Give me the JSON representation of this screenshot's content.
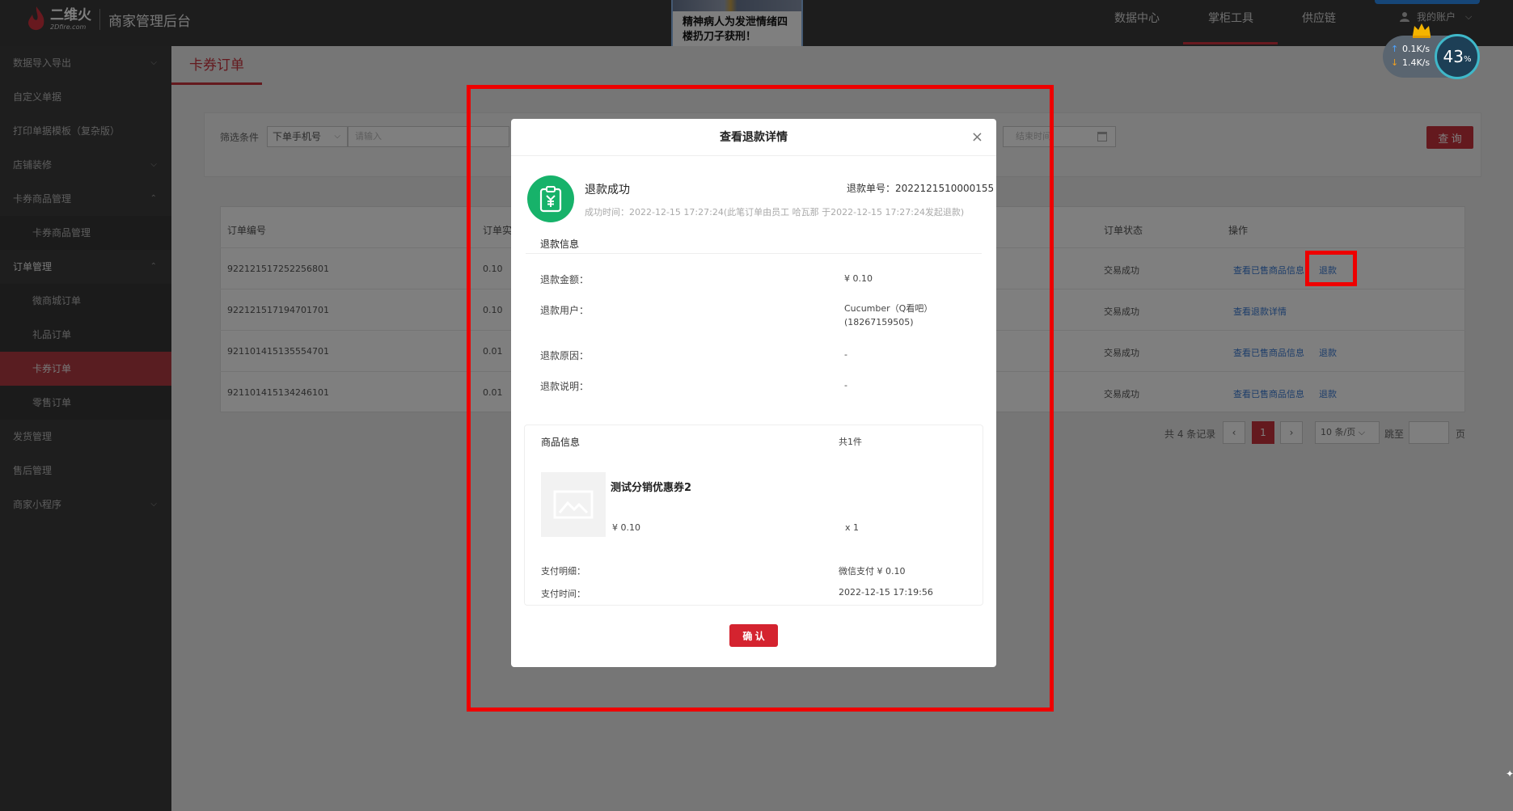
{
  "brand": {
    "logo_cn": "二维火",
    "logo_en": "2Dfire.com",
    "title": "商家管理后台"
  },
  "news": {
    "text": "精神病人为发泄情绪四楼扔刀子获刑！"
  },
  "top_nav": {
    "items": [
      "数据中心",
      "掌柜工具",
      "供应链"
    ],
    "active": "掌柜工具",
    "account": "我的账户"
  },
  "speed": {
    "up": "0.1K/s",
    "down": "1.4K/s",
    "percent": "43",
    "percent_unit": "%"
  },
  "sidebar": {
    "items": [
      {
        "label": "数据导入导出",
        "type": "group",
        "caret": "⌄"
      },
      {
        "label": "自定义单据",
        "type": "item"
      },
      {
        "label": "打印单据模板（复杂版）",
        "type": "item"
      },
      {
        "label": "店铺装修",
        "type": "group",
        "caret": "⌄"
      },
      {
        "label": "卡券商品管理",
        "type": "group",
        "caret": "⌃"
      },
      {
        "label": "卡券商品管理",
        "type": "sub"
      },
      {
        "label": "订单管理",
        "type": "group-strong",
        "caret": "⌃"
      },
      {
        "label": "微商城订单",
        "type": "sub"
      },
      {
        "label": "礼品订单",
        "type": "sub"
      },
      {
        "label": "卡券订单",
        "type": "sub-active"
      },
      {
        "label": "零售订单",
        "type": "sub"
      },
      {
        "label": "发货管理",
        "type": "item"
      },
      {
        "label": "售后管理",
        "type": "item"
      },
      {
        "label": "商家小程序",
        "type": "group",
        "caret": "⌄"
      }
    ]
  },
  "page": {
    "tab": "卡券订单"
  },
  "filter": {
    "label": "筛选条件",
    "select_value": "下单手机号",
    "input_placeholder": "请输入",
    "date_placeholder": "结束时间",
    "query_button": "查 询"
  },
  "table": {
    "headers": [
      "订单编号",
      "订单实",
      "订单状态",
      "操作"
    ],
    "rows": [
      {
        "id": "9221215172522568​01",
        "amount": "0.10",
        "status": "交易成功",
        "actions": [
          "查看已售商品信息",
          "退款"
        ]
      },
      {
        "id": "9221215171947017​01",
        "amount": "0.10",
        "status": "交易成功",
        "actions": [
          "查看退款详情"
        ]
      },
      {
        "id": "9211014151355547​01",
        "amount": "0.01",
        "status": "交易成功",
        "actions": [
          "查看已售商品信息",
          "退款"
        ]
      },
      {
        "id": "9211014151342461​01",
        "amount": "0.01",
        "status": "交易成功",
        "actions": [
          "查看已售商品信息",
          "退款"
        ]
      }
    ]
  },
  "pager": {
    "total": "共 4 条记录",
    "current_page": "1",
    "page_size": "10 条/页",
    "jump_label": "跳至",
    "page_label": "页"
  },
  "modal": {
    "title": "查看退款详情",
    "status": "退款成功",
    "refund_no": "退款单号：2022121510000155",
    "success_time": "成功时间：2022-12-15 17:27:24(此笔订单由员工 哈瓦那 于2022-12-15 17:27:24发起退款)",
    "refund_info_title": "退款信息",
    "refund_info": [
      {
        "label": "退款金额：",
        "value": "¥ 0.10"
      },
      {
        "label": "退款用户：",
        "value": "Cucumber（Q看吧）(18267159505)"
      },
      {
        "label": "退款原因：",
        "value": "-"
      },
      {
        "label": "退款说明：",
        "value": "-"
      }
    ],
    "goods": {
      "title": "商品信息",
      "count": "共1件",
      "name": "测试分销优惠券2",
      "price": "¥ 0.10",
      "qty": "x 1",
      "pay_detail_label": "支付明细：",
      "pay_detail_value": "微信支付 ¥ 0.10",
      "pay_time_label": "支付时间：",
      "pay_time_value": "2022-12-15 17:19:56"
    },
    "confirm": "确 认"
  },
  "colors": {
    "brand_red": "#c9323d",
    "success_green": "#17b26a",
    "link_blue": "#3a7bd5",
    "annotation_red": "#ee0000"
  }
}
